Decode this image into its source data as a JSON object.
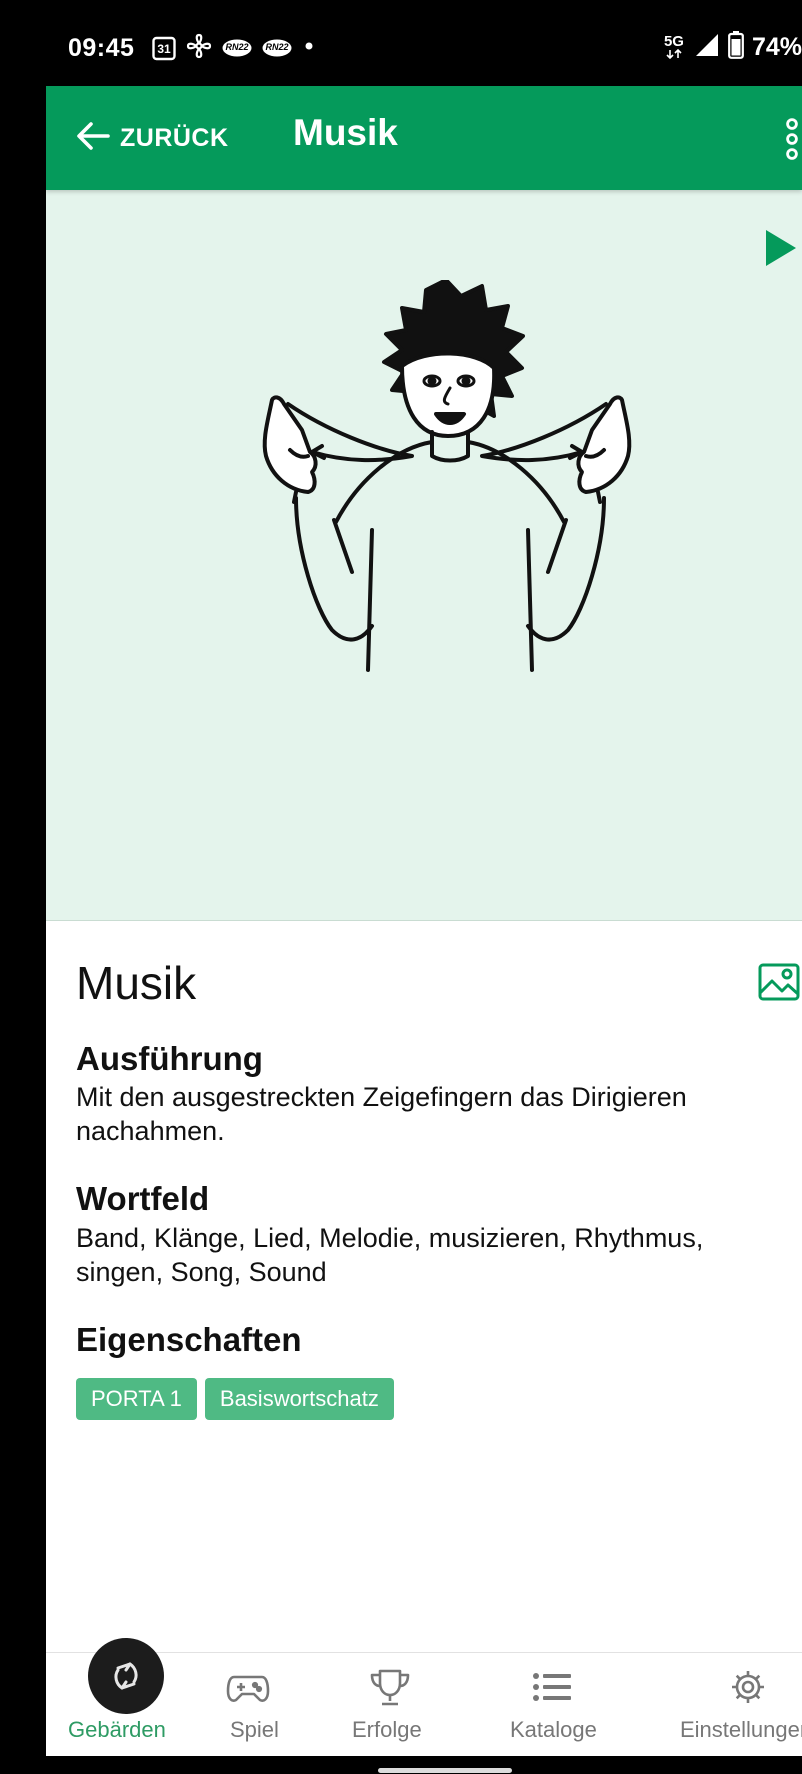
{
  "status_bar": {
    "time": "09:45",
    "calendar_day": "31",
    "news_badge_1": "RN22",
    "news_badge_2": "RN22",
    "network_label": "5G",
    "battery": "74%"
  },
  "app_bar": {
    "back_label": "ZURÜCK",
    "title": "Musik"
  },
  "detail": {
    "word": "Musik",
    "execution_heading": "Ausführung",
    "execution_text": "Mit den ausgestreckten Zeigefingern das Dirigieren nachahmen.",
    "word_field_heading": "Wortfeld",
    "word_field_text": "Band, Klänge, Lied, Melodie, musizieren, Rhythmus, singen, Song, Sound",
    "properties_heading": "Eigenschaften",
    "tags": [
      "PORTA 1",
      "Basiswortschatz"
    ]
  },
  "bottom_nav": {
    "items": [
      {
        "label": "Gebärden",
        "icon": "sign-rotate-icon",
        "active": true
      },
      {
        "label": "Spiel",
        "icon": "gamepad-icon",
        "active": false
      },
      {
        "label": "Erfolge",
        "icon": "trophy-icon",
        "active": false
      },
      {
        "label": "Kataloge",
        "icon": "list-icon",
        "active": false
      },
      {
        "label": "Einstellungen",
        "icon": "gear-icon",
        "active": false
      }
    ]
  },
  "colors": {
    "primary": "#059a5b",
    "illustration_bg": "#e4f4ec",
    "tag_bg": "#4fba84",
    "active_nav": "#2e9b64"
  }
}
